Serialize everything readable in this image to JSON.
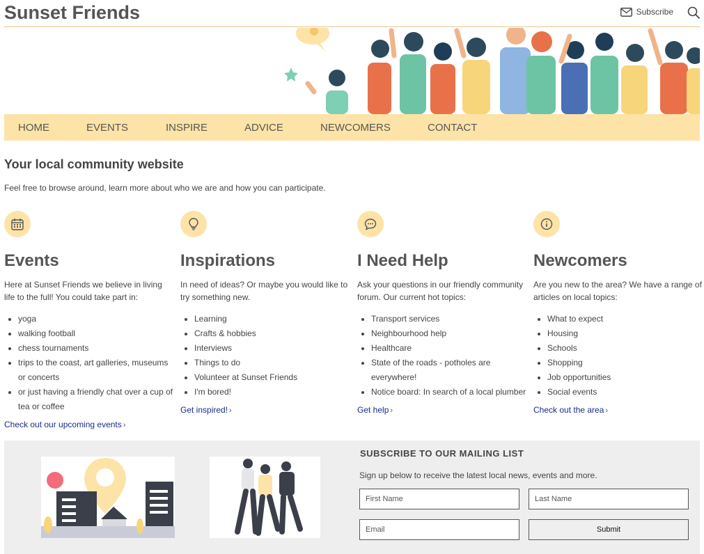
{
  "header": {
    "site_title": "Sunset Friends",
    "subscribe_label": "Subscribe"
  },
  "nav": {
    "items": [
      "HOME",
      "EVENTS",
      "INSPIRE",
      "ADVICE",
      "NEWCOMERS",
      "CONTACT"
    ]
  },
  "intro": {
    "title": "Your local community website",
    "text": "Feel free to browse around, learn more about who we are and how you can participate."
  },
  "columns": [
    {
      "icon": "calendar-icon",
      "title": "Events",
      "text": "Here at Sunset Friends we believe in living life to the full! You could take part in:",
      "items": [
        "yoga",
        "walking football",
        "chess tournaments",
        "trips to the coast, art galleries, museums or concerts",
        "or just having a friendly chat over a cup of tea or coffee"
      ],
      "link": "Check out our upcoming events"
    },
    {
      "icon": "lightbulb-icon",
      "title": "Inspirations",
      "text": "In need of ideas? Or maybe you would like to try something new.",
      "items": [
        "Learning",
        "Crafts & hobbies",
        "Interviews",
        "Things to do",
        "Volunteer at Sunset Friends",
        "I'm bored!"
      ],
      "link": "Get inspired!"
    },
    {
      "icon": "chat-bubble-icon",
      "title": "I Need Help",
      "text": "Ask your questions in our friendly community forum. Our current hot topics:",
      "items": [
        "Transport services",
        "Neighbourhood help",
        "Healthcare",
        "State of the roads - potholes are everywhere!",
        "Notice board: In search of a local plumber"
      ],
      "link": "Get help"
    },
    {
      "icon": "info-icon",
      "title": "Newcomers",
      "text": "Are you new to the area? We have a range of articles on local topics:",
      "items": [
        "What to expect",
        "Housing",
        "Schools",
        "Shopping",
        "Job opportunities",
        "Social events"
      ],
      "link": "Check out the area"
    }
  ],
  "mailing": {
    "title": "SUBSCRIBE TO OUR MAILING LIST",
    "text": "Sign up below to receive the latest local news, events and more.",
    "first_name_placeholder": "First Name",
    "last_name_placeholder": "Last Name",
    "email_placeholder": "Email",
    "submit_label": "Submit"
  },
  "colors": {
    "accent": "#fde3a7",
    "link": "#1a2a8a",
    "section_bg": "#eeeeee"
  }
}
